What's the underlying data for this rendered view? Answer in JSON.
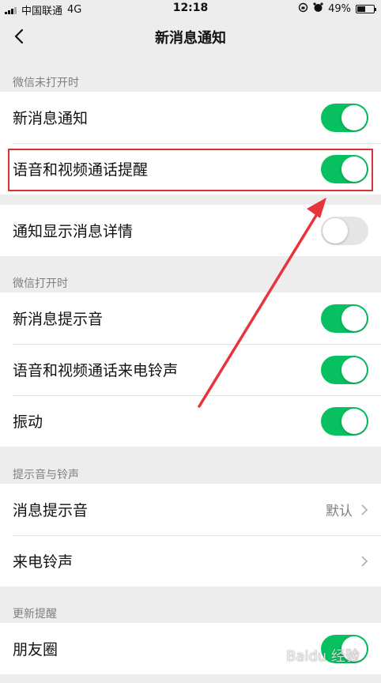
{
  "status_bar": {
    "carrier": "中国联通",
    "network": "4G",
    "time": "12:18",
    "battery_percent": "49%",
    "battery_level": 0.49
  },
  "nav": {
    "title": "新消息通知",
    "back_icon": "chevron-left-icon"
  },
  "sections": {
    "closed": {
      "header": "微信未打开时",
      "rows": [
        {
          "label": "新消息通知",
          "on": true
        },
        {
          "label": "语音和视频通话提醒",
          "on": true
        },
        {
          "label": "通知显示消息详情",
          "on": false
        }
      ]
    },
    "open": {
      "header": "微信打开时",
      "rows": [
        {
          "label": "新消息提示音",
          "on": true
        },
        {
          "label": "语音和视频通话来电铃声",
          "on": true
        },
        {
          "label": "振动",
          "on": true
        }
      ]
    },
    "sounds": {
      "header": "提示音与铃声",
      "rows": [
        {
          "label": "消息提示音",
          "value": "默认"
        },
        {
          "label": "来电铃声",
          "value": ""
        }
      ]
    },
    "updates": {
      "header": "更新提醒",
      "rows": [
        {
          "label": "朋友圈",
          "on": true
        }
      ]
    }
  },
  "annotation": {
    "highlight_color": "#d9333a",
    "arrow_color": "#e8353b"
  },
  "colors": {
    "switch_on": "#07c160",
    "switch_off": "#e5e5e5",
    "background": "#ededed"
  }
}
